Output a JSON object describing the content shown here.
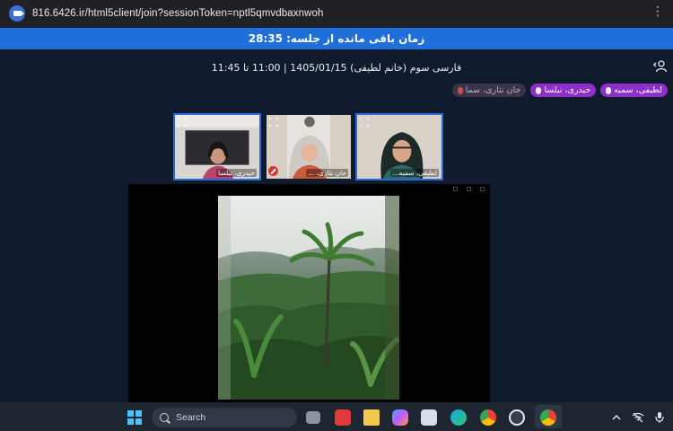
{
  "browser": {
    "url": "816.6426.ir/html5client/join?sessionToken=nptl5qmvdbaxnwoh"
  },
  "timer": {
    "text": "زمان باقی مانده از جلسه: 28:35"
  },
  "session": {
    "title": "فارسی سوم (خانم لطیفی) 1405/01/15 | 11:00 تا 11:45"
  },
  "talking": [
    {
      "label": "لطیفی، سمیه",
      "state": "active"
    },
    {
      "label": "حیدری، نیلسا",
      "state": "active"
    },
    {
      "label": "جان نثاری، سما",
      "state": "muted"
    }
  ],
  "webcams": [
    {
      "label": "حیدری، نیلسا"
    },
    {
      "label": "جان نثاری، ..."
    },
    {
      "label": "لطیفی، سمیه..."
    }
  ],
  "taskbar": {
    "search_placeholder": "Search"
  },
  "colors": {
    "accent": "#1e6fd9",
    "talking_active": "#8e2fc9",
    "background": "#0f1b2d",
    "muted": "#d6353a"
  }
}
